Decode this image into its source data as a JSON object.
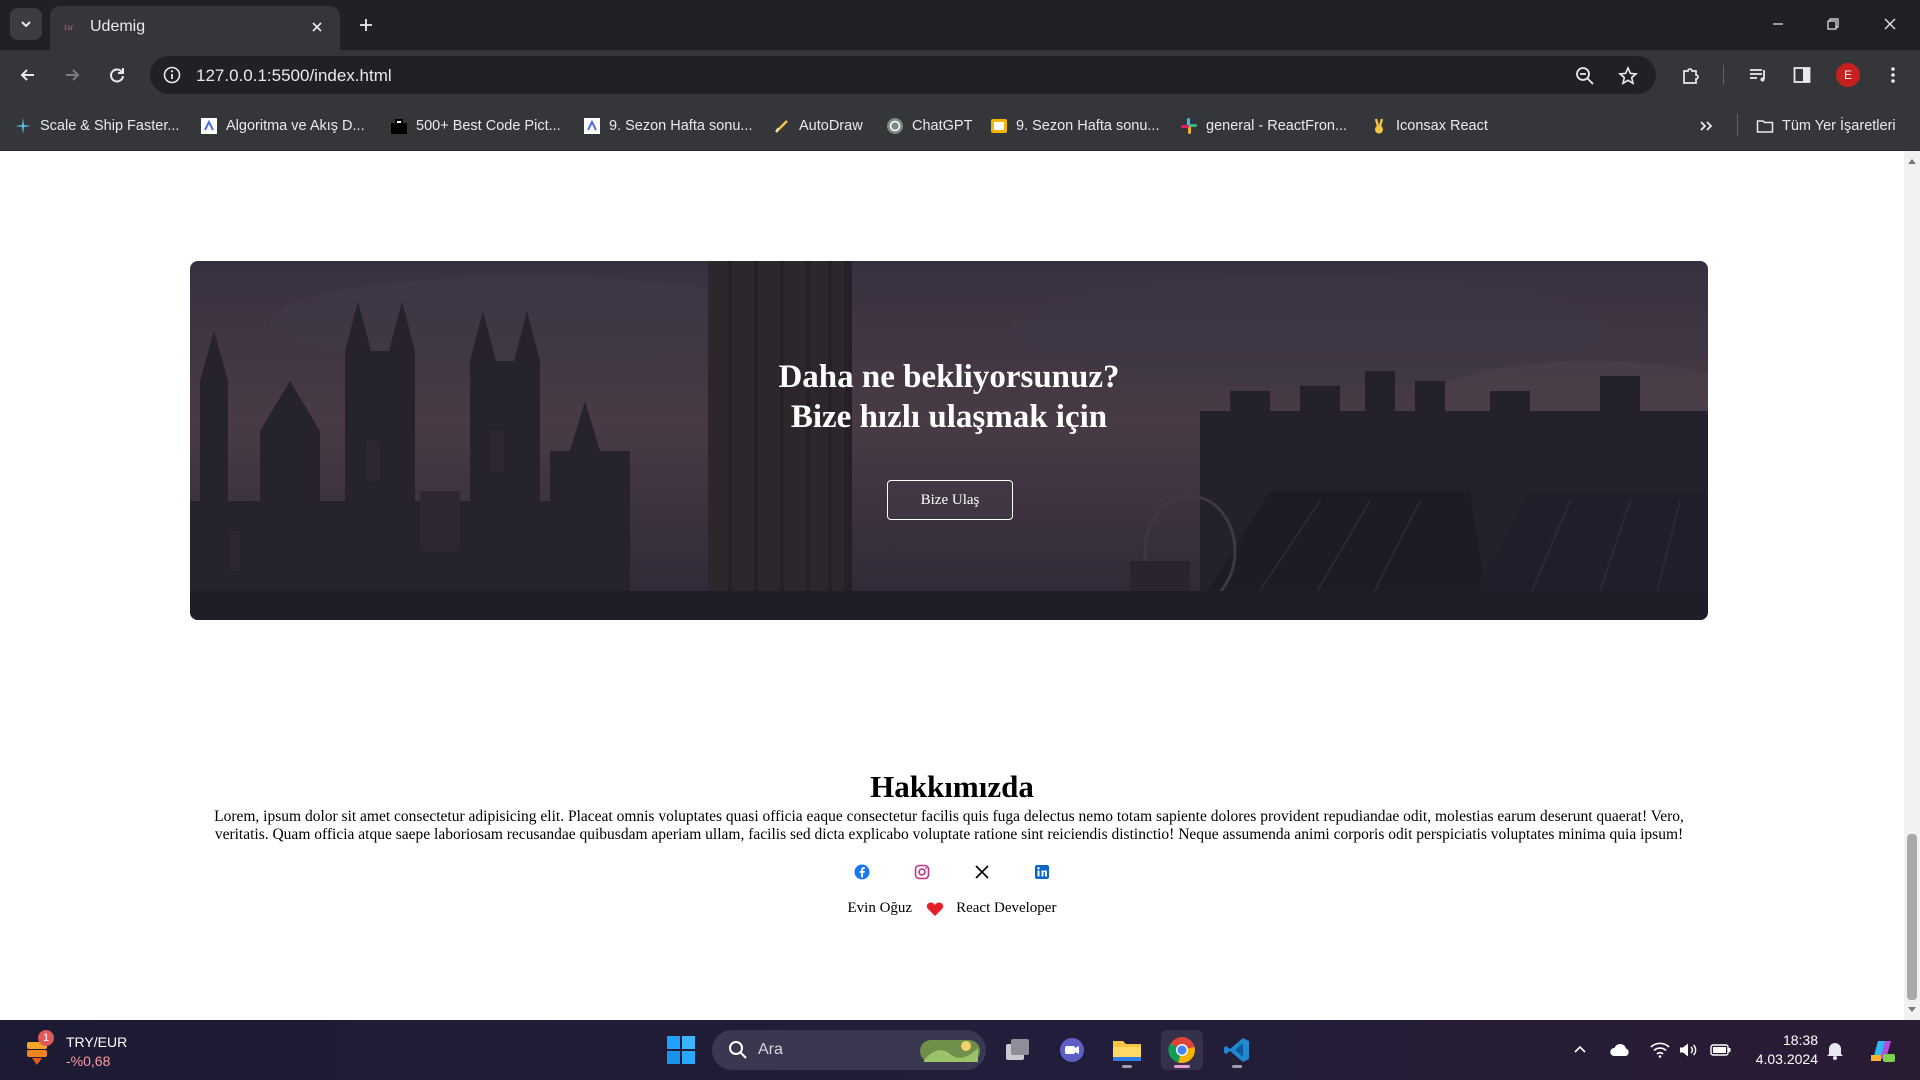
{
  "browser": {
    "tab_title": "Udemig",
    "url": "127.0.0.1:5500/index.html",
    "profile_initial": "E",
    "bookmarks": [
      "Scale & Ship Faster...",
      "Algoritma ve Akış D...",
      "500+ Best Code Pict...",
      "9. Sezon Hafta sonu...",
      "AutoDraw",
      "ChatGPT",
      "9. Sezon Hafta sonu...",
      "general - ReactFron...",
      "Iconsax React"
    ],
    "all_bookmarks": "Tüm Yer İşaretleri"
  },
  "hero": {
    "title_line1": "Daha ne bekliyorsunuz?",
    "title_line2": "Bize hızlı ulaşmak için",
    "button": "Bize Ulaş"
  },
  "about": {
    "title": "Hakkımızda",
    "text": "Lorem, ipsum dolor sit amet consectetur adipisicing elit. Placeat omnis voluptates quasi officia eaque consectetur facilis quis fuga delectus nemo totam sapiente dolores provident repudiandae odit, molestias earum deserunt quaerat! Vero, veritatis. Quam officia atque saepe laboriosam recusandae quibusdam aperiam ullam, facilis sed dicta explicabo voluptate ratione sint reiciendis distinctio! Neque assumenda animi corporis odit perspiciatis voluptates minima quia ipsum!",
    "socials": [
      "facebook-icon",
      "instagram-icon",
      "x-icon",
      "linkedin-icon"
    ],
    "author": "Evin Oğuz",
    "role": "React Developer"
  },
  "taskbar": {
    "widget_name": "TRY/EUR",
    "widget_change": "-%0,68",
    "widget_badge": "1",
    "search_label": "Ara",
    "time": "18:38",
    "date": "4.03.2024"
  },
  "colors": {
    "facebook": "#1877f2",
    "instagram": "#c13584",
    "linkedin": "#0a66c2",
    "heart": "#e41e26"
  }
}
